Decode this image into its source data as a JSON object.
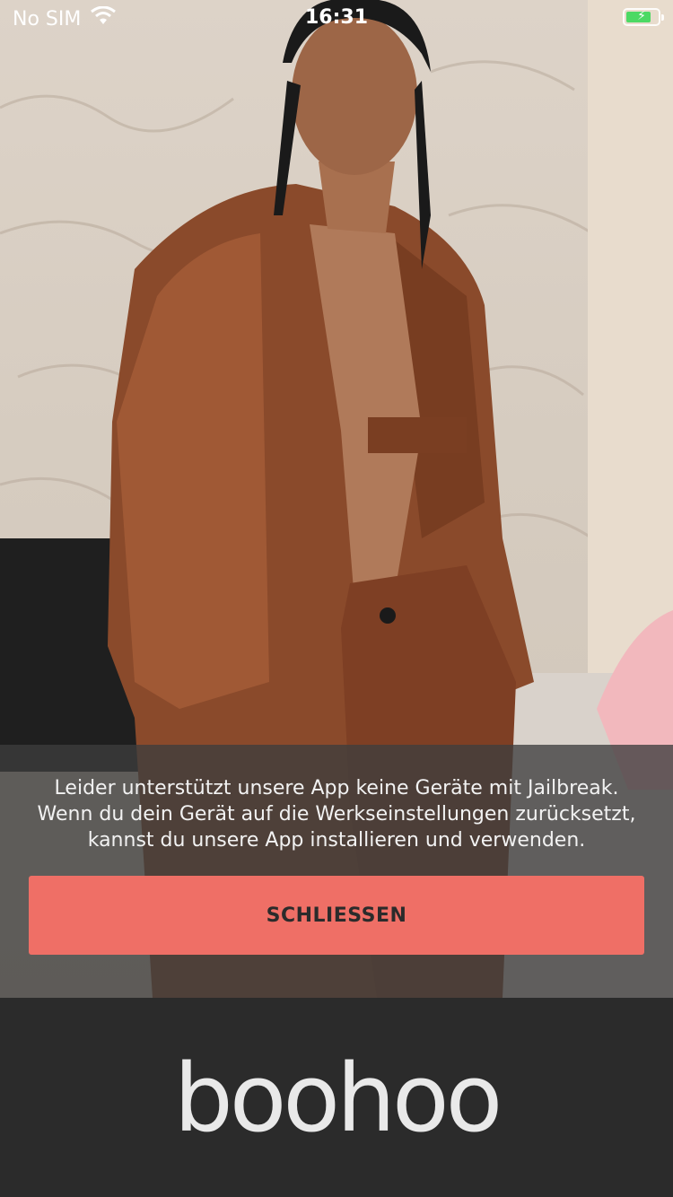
{
  "status_bar": {
    "carrier": "No SIM",
    "time": "16:31",
    "wifi_icon": "wifi-icon",
    "battery_icon": "battery-charging-icon",
    "battery_level": 0.8,
    "battery_color": "#4cd964"
  },
  "hero": {
    "description_icon": "hero-photo"
  },
  "dialog": {
    "message": "Leider unterstützt unsere App keine Geräte mit Jailbreak. Wenn du dein Gerät auf die Werkseinstellungen zurücksetzt, kannst du unsere App installieren und verwenden.",
    "button_label": "SCHLIESSEN",
    "button_color": "#ef6f66"
  },
  "brand": {
    "logo_text": "boohoo"
  }
}
